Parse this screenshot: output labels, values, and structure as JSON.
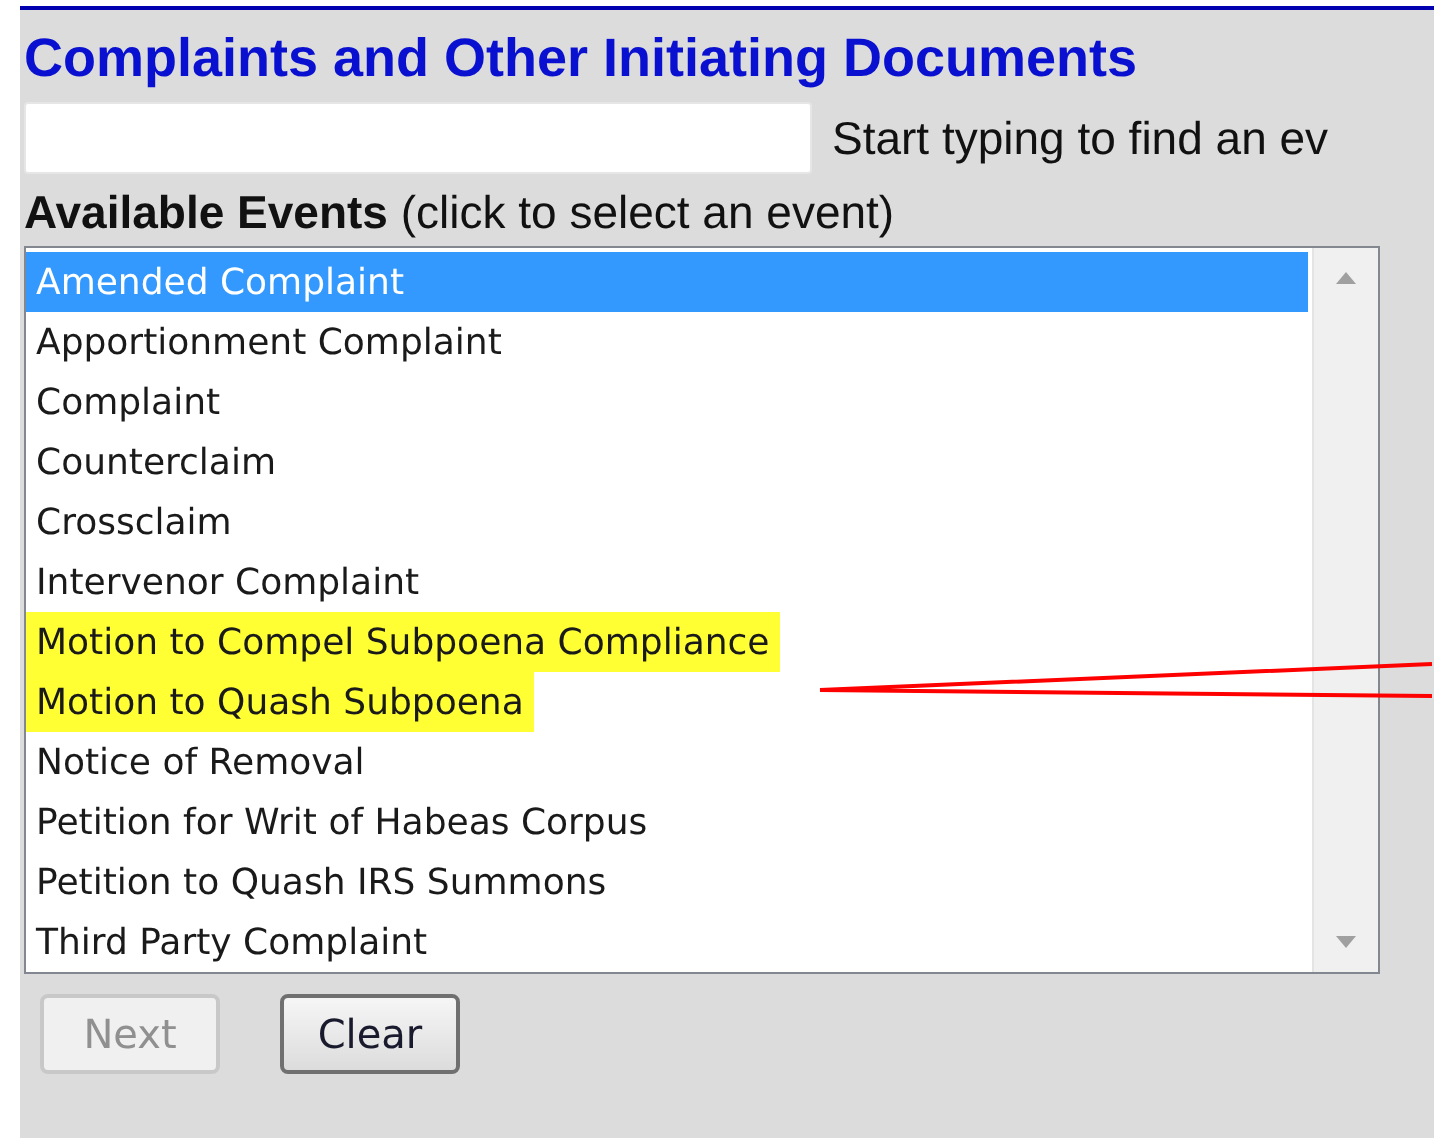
{
  "heading": "Complaints and Other Initiating Documents",
  "search": {
    "hint": "Start typing to find an ev"
  },
  "events_label": {
    "title": "Available Events",
    "note": "(click to select an event)"
  },
  "events": [
    {
      "label": "Amended Complaint",
      "selected": true,
      "highlighted": false
    },
    {
      "label": "Apportionment Complaint",
      "selected": false,
      "highlighted": false
    },
    {
      "label": "Complaint",
      "selected": false,
      "highlighted": false
    },
    {
      "label": "Counterclaim",
      "selected": false,
      "highlighted": false
    },
    {
      "label": "Crossclaim",
      "selected": false,
      "highlighted": false
    },
    {
      "label": "Intervenor Complaint",
      "selected": false,
      "highlighted": false
    },
    {
      "label": "Motion to Compel Subpoena Compliance",
      "selected": false,
      "highlighted": true
    },
    {
      "label": "Motion to Quash Subpoena",
      "selected": false,
      "highlighted": true
    },
    {
      "label": "Notice of Removal",
      "selected": false,
      "highlighted": false
    },
    {
      "label": "Petition for Writ of Habeas Corpus",
      "selected": false,
      "highlighted": false
    },
    {
      "label": "Petition to Quash IRS Summons",
      "selected": false,
      "highlighted": false
    },
    {
      "label": "Third Party Complaint",
      "selected": false,
      "highlighted": false
    }
  ],
  "buttons": [
    {
      "label": "Next",
      "disabled": true
    },
    {
      "label": "Clear",
      "disabled": false
    }
  ]
}
